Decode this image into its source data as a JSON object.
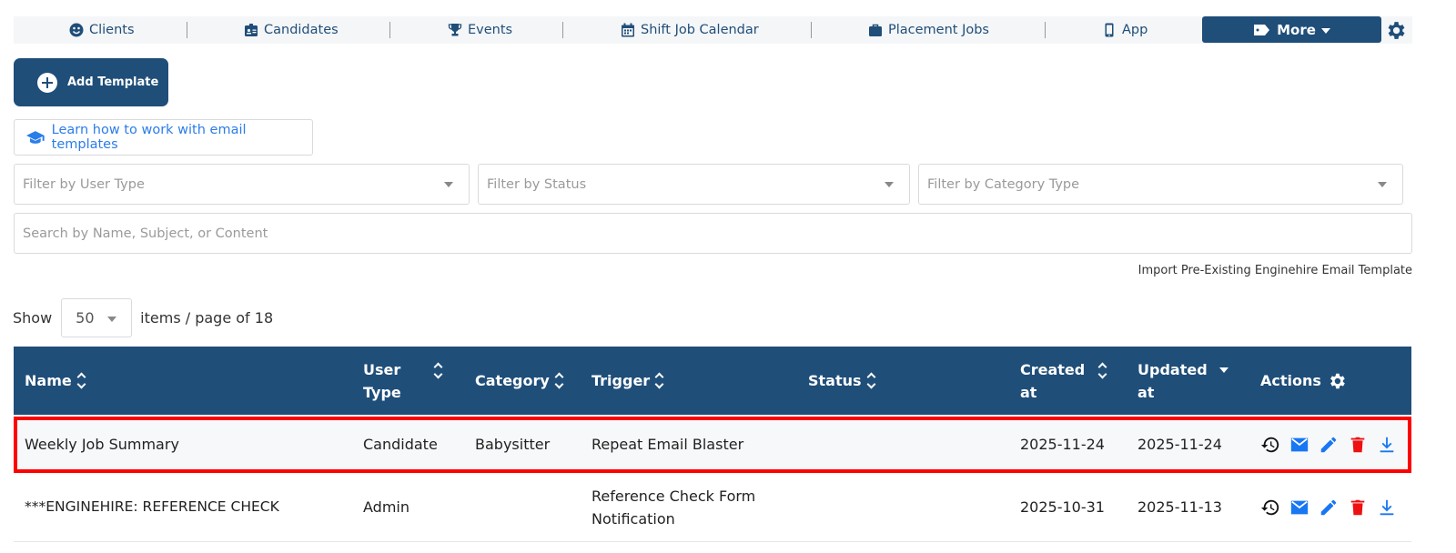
{
  "nav": {
    "items": [
      {
        "label": "Clients",
        "icon": "smiley-icon"
      },
      {
        "label": "Candidates",
        "icon": "id-badge-icon"
      },
      {
        "label": "Events",
        "icon": "trophy-icon"
      },
      {
        "label": "Shift Job Calendar",
        "icon": "calendar-icon"
      },
      {
        "label": "Placement Jobs",
        "icon": "briefcase-icon"
      },
      {
        "label": "App",
        "icon": "mobile-icon"
      }
    ],
    "more_label": "More"
  },
  "toolbar": {
    "add_template_label": "Add Template",
    "learn_label": "Learn how to work with email templates"
  },
  "filters": {
    "user_type_placeholder": "Filter by User Type",
    "status_placeholder": "Filter by Status",
    "category_placeholder": "Filter by Category Type",
    "search_placeholder": "Search by Name, Subject, or Content"
  },
  "import_link": "Import Pre-Existing Enginehire Email Template",
  "pagination": {
    "show_label": "Show",
    "page_size": "50",
    "suffix": "items / page of 18"
  },
  "table": {
    "headers": {
      "name": "Name",
      "user_type": "User Type",
      "category": "Category",
      "trigger": "Trigger",
      "status": "Status",
      "created_at": "Created at",
      "updated_at": "Updated at",
      "actions": "Actions"
    },
    "rows": [
      {
        "name": "Weekly Job Summary",
        "user_type": "Candidate",
        "category": "Babysitter",
        "trigger": "Repeat Email Blaster",
        "status": "",
        "created_at": "2025-11-24",
        "updated_at": "2025-11-24"
      },
      {
        "name": "***ENGINEHIRE: REFERENCE CHECK",
        "user_type": "Admin",
        "category": "",
        "trigger": "Reference Check Form Notification",
        "status": "",
        "created_at": "2025-10-31",
        "updated_at": "2025-11-13"
      }
    ]
  },
  "colors": {
    "primary": "#1f4e79",
    "link": "#2b7de9",
    "highlight": "#ff0000",
    "delete": "#ee1111"
  }
}
